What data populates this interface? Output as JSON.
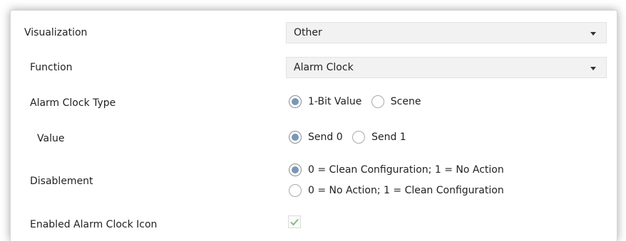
{
  "rows": {
    "visualization": {
      "label": "Visualization",
      "value": "Other"
    },
    "function": {
      "label": "Function",
      "value": "Alarm Clock"
    },
    "alarm_type": {
      "label": "Alarm Clock Type",
      "options": [
        "1-Bit Value",
        "Scene"
      ],
      "selected": "1-Bit Value"
    },
    "value": {
      "label": "Value",
      "options": [
        "Send 0",
        "Send 1"
      ],
      "selected": "Send 0"
    },
    "disablement": {
      "label": "Disablement",
      "options": [
        "0 = Clean Configuration; 1 = No Action",
        "0 = No Action; 1 = Clean Configuration"
      ],
      "selected": "0 = Clean Configuration; 1 = No Action"
    },
    "icon": {
      "label": "Enabled Alarm Clock Icon",
      "checked": true
    }
  },
  "colors": {
    "radio_selected": "#7a96b7",
    "check": "#7fbf7f"
  },
  "icons": {
    "dropdown": "chevron-down-icon",
    "check": "check-icon"
  }
}
